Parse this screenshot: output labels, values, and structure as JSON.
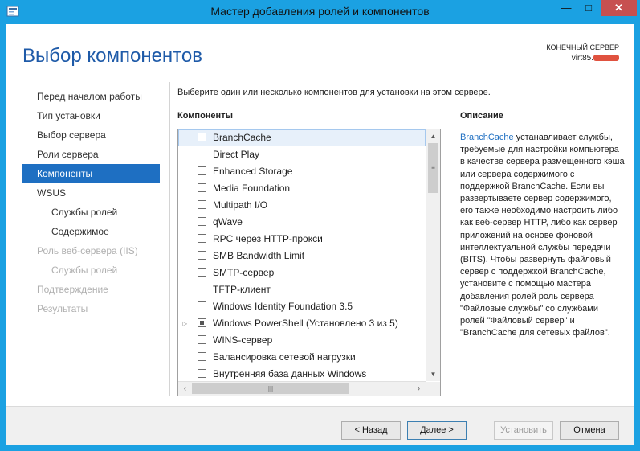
{
  "window": {
    "title": "Мастер добавления ролей и компонентов",
    "controls": {
      "minimize": "—",
      "maximize": "□",
      "close": "✕"
    },
    "accent_color": "#1ba1e2"
  },
  "header": {
    "page_title": "Выбор компонентов",
    "destination_label": "КОНЕЧНЫЙ СЕРВЕР",
    "destination_server": "virt85."
  },
  "nav": {
    "items": [
      {
        "label": "Перед началом работы",
        "state": "normal",
        "level": 0
      },
      {
        "label": "Тип установки",
        "state": "normal",
        "level": 0
      },
      {
        "label": "Выбор сервера",
        "state": "normal",
        "level": 0
      },
      {
        "label": "Роли сервера",
        "state": "normal",
        "level": 0
      },
      {
        "label": "Компоненты",
        "state": "active",
        "level": 0
      },
      {
        "label": "WSUS",
        "state": "normal",
        "level": 0
      },
      {
        "label": "Службы ролей",
        "state": "normal",
        "level": 1
      },
      {
        "label": "Содержимое",
        "state": "normal",
        "level": 1
      },
      {
        "label": "Роль веб-сервера (IIS)",
        "state": "disabled",
        "level": 0
      },
      {
        "label": "Службы ролей",
        "state": "disabled",
        "level": 1
      },
      {
        "label": "Подтверждение",
        "state": "disabled",
        "level": 0
      },
      {
        "label": "Результаты",
        "state": "disabled",
        "level": 0
      }
    ]
  },
  "main": {
    "instruction": "Выберите один или несколько компонентов для установки на этом сервере.",
    "components_header": "Компоненты",
    "description_header": "Описание",
    "components": [
      {
        "label": "BranchCache",
        "checked": false,
        "selected": true
      },
      {
        "label": "Direct Play",
        "checked": false
      },
      {
        "label": "Enhanced Storage",
        "checked": false
      },
      {
        "label": "Media Foundation",
        "checked": false
      },
      {
        "label": "Multipath I/O",
        "checked": false
      },
      {
        "label": "qWave",
        "checked": false
      },
      {
        "label": "RPC через HTTP-прокси",
        "checked": false
      },
      {
        "label": "SMB Bandwidth Limit",
        "checked": false
      },
      {
        "label": "SMTP-сервер",
        "checked": false
      },
      {
        "label": "TFTP-клиент",
        "checked": false
      },
      {
        "label": "Windows Identity Foundation 3.5",
        "checked": false
      },
      {
        "label": "Windows PowerShell (Установлено 3 из 5)",
        "checked": "partial",
        "expandable": true
      },
      {
        "label": "WINS-сервер",
        "checked": false
      },
      {
        "label": "Балансировка сетевой нагрузки",
        "checked": false
      },
      {
        "label": "Внутренняя база данных Windows",
        "checked": false
      }
    ],
    "description": {
      "link_text": "BranchCache",
      "text": " устанавливает службы, требуемые для настройки компьютера в качестве сервера размещенного кэша или сервера содержимого с поддержкой BranchCache. Если вы развертываете сервер содержимого, его также необходимо настроить либо как веб-сервер HTTP, либо как сервер приложений на основе фоновой интеллектуальной службы передачи (BITS). Чтобы развернуть файловый сервер с поддержкой BranchCache, установите с помощью мастера добавления ролей роль сервера \"Файловые службы\" со службами ролей \"Файловый сервер\" и \"BranchCache для сетевых файлов\"."
    }
  },
  "footer": {
    "back_label": "< Назад",
    "next_label": "Далее >",
    "install_label": "Установить",
    "cancel_label": "Отмена"
  }
}
